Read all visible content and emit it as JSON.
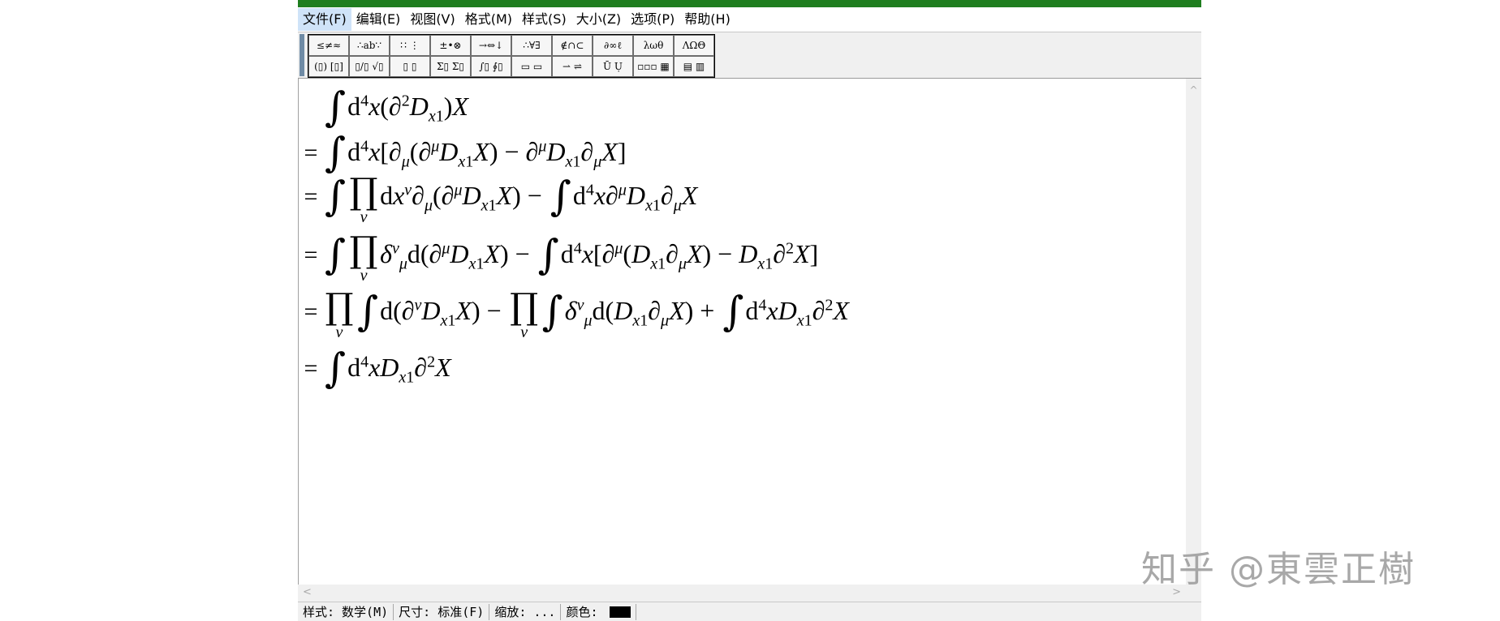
{
  "app": {
    "titlebar_color": "#1f7e1f"
  },
  "menu": [
    {
      "label": "文件(F)",
      "active": true
    },
    {
      "label": "编辑(E)"
    },
    {
      "label": "视图(V)"
    },
    {
      "label": "格式(M)"
    },
    {
      "label": "样式(S)"
    },
    {
      "label": "大小(Z)"
    },
    {
      "label": "选项(P)"
    },
    {
      "label": "帮助(H)"
    }
  ],
  "palette": {
    "row1": [
      "≤≠≈",
      "∴ab∵",
      "∷ ⋮",
      "±•⊗",
      "→⇔↓",
      "∴∀∃",
      "∉∩⊂",
      "∂∞ℓ",
      "λωθ",
      "ΛΩΘ"
    ],
    "row2": [
      "(▯) [▯]",
      "▯/▯ √▯",
      "▯ ▯",
      "Σ▯ Σ▯",
      "∫▯ ∮▯",
      "▭ ▭",
      "⇀ ⇌",
      "Ū Ụ",
      "▫▫▫ ▦",
      "▤ ▥"
    ]
  },
  "equations": [
    {
      "prefix": "",
      "lines": "∫ d⁴x(∂²D_x1)X"
    },
    {
      "prefix": "=",
      "lines": "∫ d⁴x[∂_μ(∂^μ D_x1 X) − ∂^μ D_x1 ∂_μ X]"
    },
    {
      "prefix": "=",
      "lines": "∫ ∏_ν dx^ν ∂_μ(∂^μ D_x1 X) − ∫ d⁴x ∂^μ D_x1 ∂_μ X"
    },
    {
      "prefix": "=",
      "lines": "∫ ∏_ν δ^ν_μ d(∂^μ D_x1 X) − ∫ d⁴x[∂^μ(D_x1 ∂_μ X) − D_x1 ∂² X]"
    },
    {
      "prefix": "=",
      "lines": "∏_ν ∫ d(∂^ν D_x1 X) − ∏_ν ∫ δ^ν_μ d(D_x1 ∂_μ X) + ∫ d⁴x D_x1 ∂² X"
    },
    {
      "prefix": "=",
      "lines": "∫ d⁴x D_x1 ∂² X"
    }
  ],
  "status": {
    "style": "样式: 数学(M)",
    "size": "尺寸: 标准(F)",
    "zoom": "缩放: ...",
    "color_label": "颜色:",
    "color_value": "#000000"
  },
  "scroll": {
    "up": "^",
    "left": "<",
    "right": ">"
  },
  "watermark": "知乎 @東雲正樹"
}
